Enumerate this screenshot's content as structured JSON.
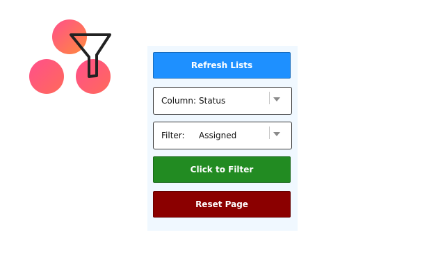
{
  "logo": {
    "icon": "funnel-icon",
    "circle_gradient": [
      "#ff4f8b",
      "#ff8a3d"
    ],
    "funnel_color": "#222222"
  },
  "controls": {
    "refresh_label": "Refresh Lists",
    "column": {
      "label": "Column:",
      "value": "Status"
    },
    "filter": {
      "label": "Filter:",
      "value": "Assigned"
    },
    "apply_label": "Click to Filter",
    "reset_label": "Reset Page"
  },
  "colors": {
    "refresh": "#1e90ff",
    "apply": "#228b22",
    "reset": "#8b0000",
    "panel": "#f0f8ff"
  }
}
